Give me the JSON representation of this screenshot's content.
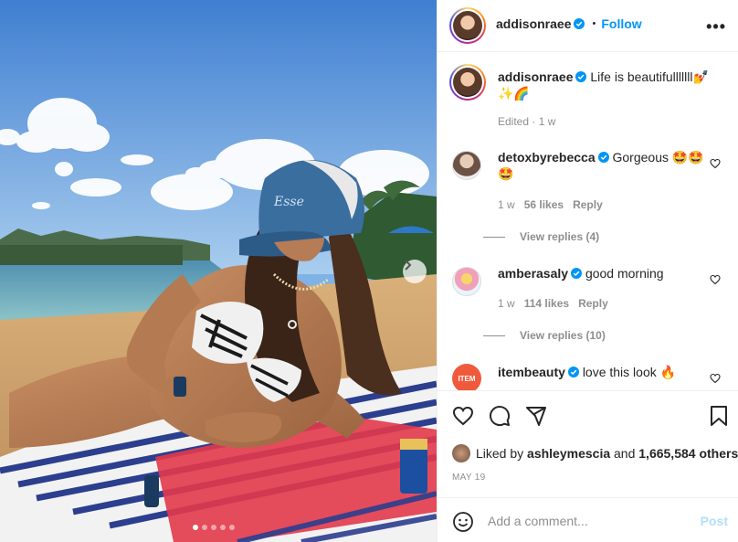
{
  "post": {
    "username": "addisonraee",
    "follow_label": "Follow",
    "separator": "•",
    "more_label": "•••",
    "caption_username": "addisonraee",
    "caption_text": "Life is beautifulllllll",
    "caption_emoji_1": "💅",
    "caption_emoji_2": "✨🌈",
    "edited_label": "Edited · 1 w"
  },
  "comments": [
    {
      "username": "detoxbyrebecca",
      "text": "Gorgeous 🤩🤩",
      "text_line2": "🤩",
      "age": "1 w",
      "likes": "56 likes",
      "reply": "Reply",
      "view_replies": "View replies (4)"
    },
    {
      "username": "amberasaly",
      "text": "good morning",
      "age": "1 w",
      "likes": "114 likes",
      "reply": "Reply",
      "view_replies": "View replies (10)"
    },
    {
      "username": "itembeauty",
      "text": "love this look 🔥",
      "avatar_text": "ITEM"
    }
  ],
  "actions": {
    "liked_prefix": "Liked by",
    "liked_user": "ashleymescia",
    "liked_and": "and",
    "liked_count": "1,665,584 others",
    "date": "MAY 19"
  },
  "add_comment": {
    "placeholder": "Add a comment...",
    "post_label": "Post"
  },
  "carousel": {
    "slide_count": 5,
    "active_index": 0
  },
  "colors": {
    "accent": "#0095f6",
    "verified": "#0095f6",
    "post_disabled": "#b2dffc",
    "muted": "#8e8e8e"
  },
  "icons": [
    "verified-badge-icon",
    "more-icon",
    "heart-icon",
    "comment-icon",
    "share-icon",
    "save-icon",
    "emoji-icon",
    "chevron-right-icon"
  ]
}
